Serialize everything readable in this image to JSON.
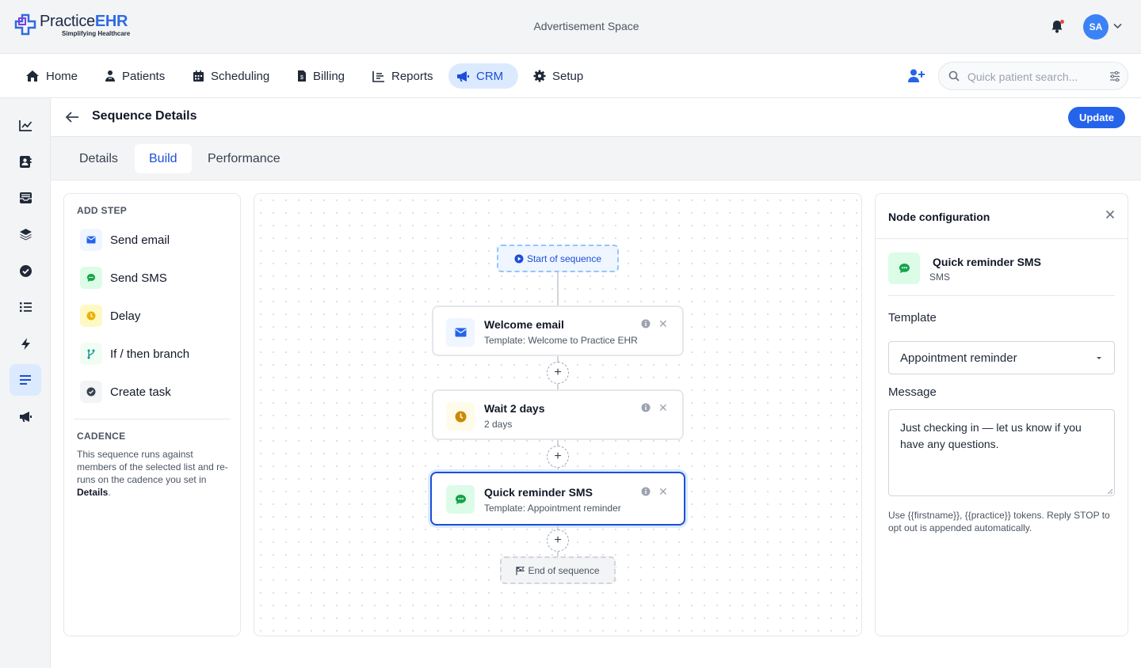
{
  "brand": {
    "name_plain": "Practice",
    "name_bold": "EHR",
    "tagline": "Simplifying Healthcare"
  },
  "top": {
    "ad_text": "Advertisement Space",
    "avatar_initials": "SA"
  },
  "nav": {
    "items": [
      {
        "label": "Home",
        "icon": "home-icon"
      },
      {
        "label": "Patients",
        "icon": "patients-icon"
      },
      {
        "label": "Scheduling",
        "icon": "calendar-icon"
      },
      {
        "label": "Billing",
        "icon": "billing-icon"
      },
      {
        "label": "Reports",
        "icon": "reports-icon"
      },
      {
        "label": "CRM",
        "icon": "megaphone-icon",
        "active": true
      },
      {
        "label": "Setup",
        "icon": "gear-icon"
      }
    ],
    "search_placeholder": "Quick patient search..."
  },
  "sidebar": {
    "icons": [
      "chart-line-icon",
      "contact-book-icon",
      "inbox-icon",
      "layers-icon",
      "check-circle-icon",
      "list-icon",
      "bolt-icon",
      "sequence-icon",
      "megaphone-icon"
    ],
    "active_index": 7
  },
  "page": {
    "title": "Sequence Details",
    "update_label": "Update",
    "tabs": [
      {
        "label": "Details"
      },
      {
        "label": "Build",
        "active": true
      },
      {
        "label": "Performance"
      }
    ]
  },
  "add_step": {
    "heading": "ADD STEP",
    "steps": [
      {
        "label": "Send email",
        "icon": "envelope-icon"
      },
      {
        "label": "Send SMS",
        "icon": "chat-icon"
      },
      {
        "label": "Delay",
        "icon": "clock-icon"
      },
      {
        "label": "If / then branch",
        "icon": "branch-icon"
      },
      {
        "label": "Create task",
        "icon": "check-circle-icon"
      }
    ],
    "cadence_heading": "CADENCE",
    "cadence_text": "This sequence runs against members of the selected list and re-runs on the cadence you set in ",
    "cadence_link": "Details",
    "cadence_end": "."
  },
  "canvas": {
    "start_label": "Start of sequence",
    "end_label": "End of sequence",
    "nodes": [
      {
        "title": "Welcome email",
        "subtitle": "Template: Welcome to Practice EHR",
        "icon": "envelope-icon"
      },
      {
        "title": "Wait 2 days",
        "subtitle": "2 days",
        "icon": "clock-icon"
      },
      {
        "title": "Quick reminder SMS",
        "subtitle": "Template: Appointment reminder",
        "icon": "chat-icon",
        "selected": true
      }
    ]
  },
  "config": {
    "heading": "Node configuration",
    "node_name": "Quick reminder SMS",
    "node_type": "SMS",
    "template_label": "Template",
    "template_value": "Appointment reminder",
    "message_label": "Message",
    "message_value": "Just checking in — let us know if you have any questions.",
    "help_text": "Use {{firstname}}, {{practice}} tokens. Reply STOP to opt out is appended automatically."
  },
  "colors": {
    "primary": "#2563eb",
    "email": "#2563eb",
    "sms": "#16a34a",
    "delay": "#ca8a04"
  }
}
